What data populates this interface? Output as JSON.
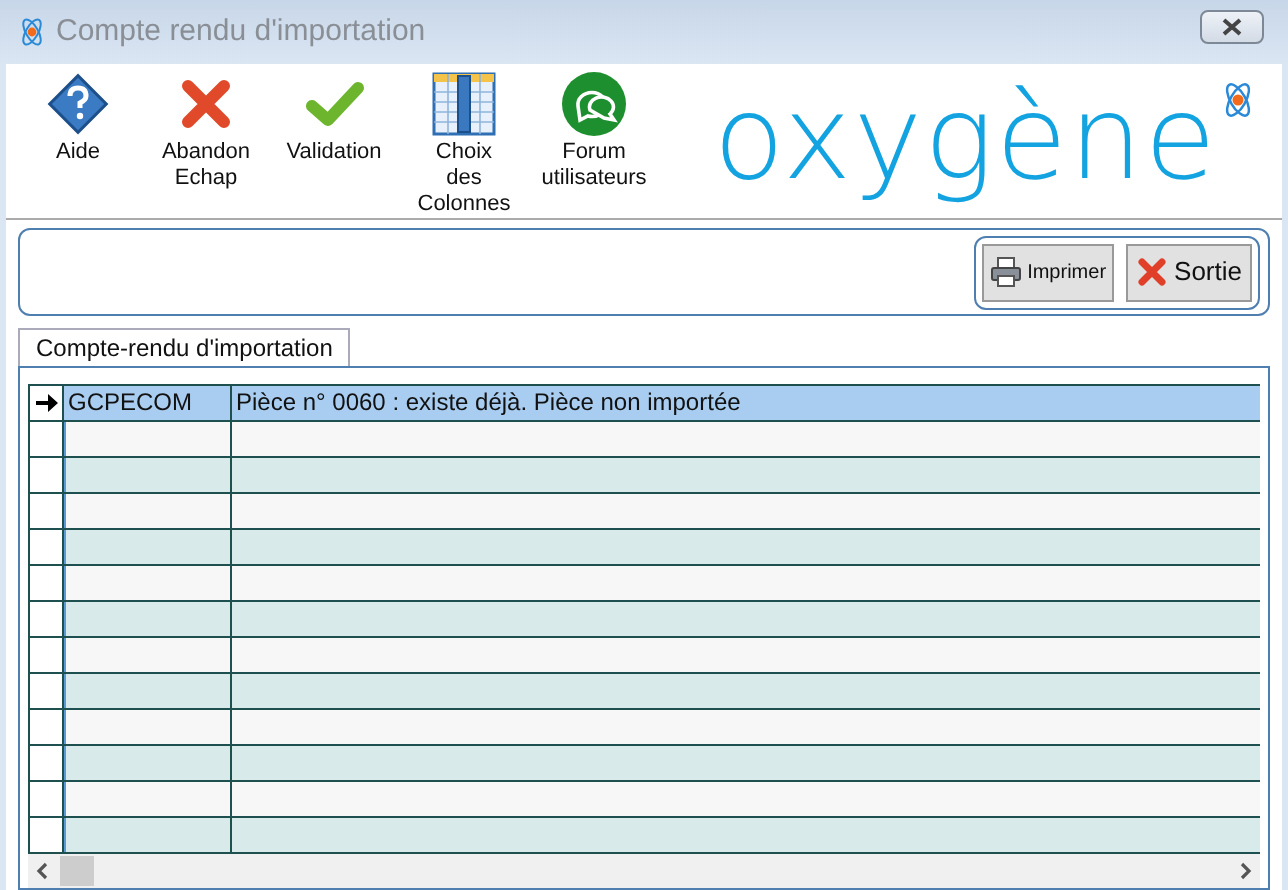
{
  "window": {
    "title": "Compte rendu d'importation"
  },
  "toolbar": [
    {
      "kind": "help",
      "label": "Aide"
    },
    {
      "kind": "cancel",
      "label": "Abandon\nEchap"
    },
    {
      "kind": "validate",
      "label": "Validation"
    },
    {
      "kind": "columns",
      "label": "Choix\ndes\nColonnes"
    },
    {
      "kind": "forum",
      "label": "Forum\nutilisateurs"
    }
  ],
  "logo": {
    "text": "oxygène"
  },
  "actions": [
    {
      "kind": "print",
      "label": "Imprimer"
    },
    {
      "kind": "exit",
      "label": "Sortie"
    }
  ],
  "tabs": [
    {
      "label": "Compte-rendu d'importation",
      "selected": true
    }
  ],
  "table": {
    "rows": [
      {
        "selected": true,
        "current": true,
        "column_1": "GCPECOM",
        "column_2": "Pièce n° 0060 : existe déjà. Pièce non importée"
      }
    ]
  }
}
